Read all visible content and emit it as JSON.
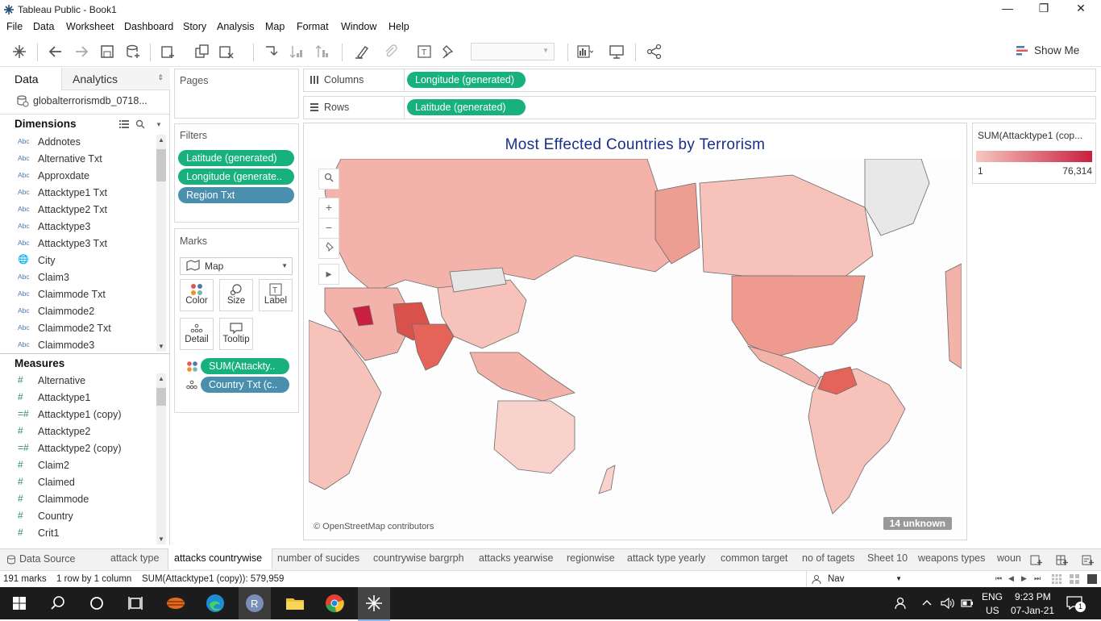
{
  "window": {
    "title": "Tableau Public - Book1",
    "minimize": "—",
    "restore": "❐",
    "close": "✕"
  },
  "menu": [
    "File",
    "Data",
    "Worksheet",
    "Dashboard",
    "Story",
    "Analysis",
    "Map",
    "Format",
    "Window",
    "Help"
  ],
  "toolbar": {
    "show_me": "Show Me"
  },
  "left": {
    "tab_data": "Data",
    "tab_analytics": "Analytics",
    "datasource": "globalterrorismdb_0718...",
    "dimensions_title": "Dimensions",
    "dimensions": [
      {
        "type": "Abc",
        "label": "Addnotes"
      },
      {
        "type": "Abc",
        "label": "Alternative Txt"
      },
      {
        "type": "Abc",
        "label": "Approxdate"
      },
      {
        "type": "Abc",
        "label": "Attacktype1 Txt"
      },
      {
        "type": "Abc",
        "label": "Attacktype2 Txt"
      },
      {
        "type": "Abc",
        "label": "Attacktype3"
      },
      {
        "type": "Abc",
        "label": "Attacktype3 Txt"
      },
      {
        "type": "globe",
        "label": "City"
      },
      {
        "type": "Abc",
        "label": "Claim3"
      },
      {
        "type": "Abc",
        "label": "Claimmode Txt"
      },
      {
        "type": "Abc",
        "label": "Claimmode2"
      },
      {
        "type": "Abc",
        "label": "Claimmode2 Txt"
      },
      {
        "type": "Abc",
        "label": "Claimmode3"
      }
    ],
    "measures_title": "Measures",
    "measures": [
      {
        "type": "#",
        "label": "Alternative"
      },
      {
        "type": "#",
        "label": "Attacktype1"
      },
      {
        "type": "=#",
        "label": "Attacktype1 (copy)"
      },
      {
        "type": "#",
        "label": "Attacktype2"
      },
      {
        "type": "=#",
        "label": "Attacktype2 (copy)"
      },
      {
        "type": "#",
        "label": "Claim2"
      },
      {
        "type": "#",
        "label": "Claimed"
      },
      {
        "type": "#",
        "label": "Claimmode"
      },
      {
        "type": "#",
        "label": "Country"
      },
      {
        "type": "#",
        "label": "Crit1"
      }
    ]
  },
  "pages": {
    "title": "Pages"
  },
  "filters": {
    "title": "Filters",
    "items": [
      "Latitude (generated)",
      "Longitude (generate..",
      "Region Txt"
    ]
  },
  "marks": {
    "title": "Marks",
    "type": "Map",
    "buttons": {
      "color": "Color",
      "size": "Size",
      "label": "Label",
      "detail": "Detail",
      "tooltip": "Tooltip"
    },
    "fields": [
      "SUM(Attackty..",
      "Country Txt (c.."
    ]
  },
  "columns": {
    "label": "Columns",
    "pill": "Longitude (generated)"
  },
  "rows": {
    "label": "Rows",
    "pill": "Latitude (generated)"
  },
  "view": {
    "title": "Most Effected Countries by Terrorism",
    "attribution": "© OpenStreetMap contributors",
    "unknown": "14 unknown"
  },
  "legend": {
    "title": "SUM(Attacktype1 (cop...",
    "min": "1",
    "max": "76,314",
    "color_low": "#f6c7c0",
    "color_high": "#c8203e"
  },
  "tabs": {
    "datasource": "Data Source",
    "sheets": [
      "attack type",
      "attacks countrywise",
      "number of sucides",
      "countrywise bargrph",
      "attacks yearwise",
      "regionwise",
      "attack type yearly",
      "common target",
      "no of tagets",
      "Sheet 10",
      "weapons types",
      "woun"
    ],
    "active": "attacks countrywise"
  },
  "status": {
    "marks": "191 marks",
    "rows": "1 row by 1 column",
    "sum": "SUM(Attacktype1 (copy)): 579,959",
    "nav": "Nav"
  },
  "taskbar": {
    "lang1": "ENG",
    "lang2": "US",
    "time": "9:23 PM",
    "date": "07-Jan-21",
    "notif": "1"
  }
}
